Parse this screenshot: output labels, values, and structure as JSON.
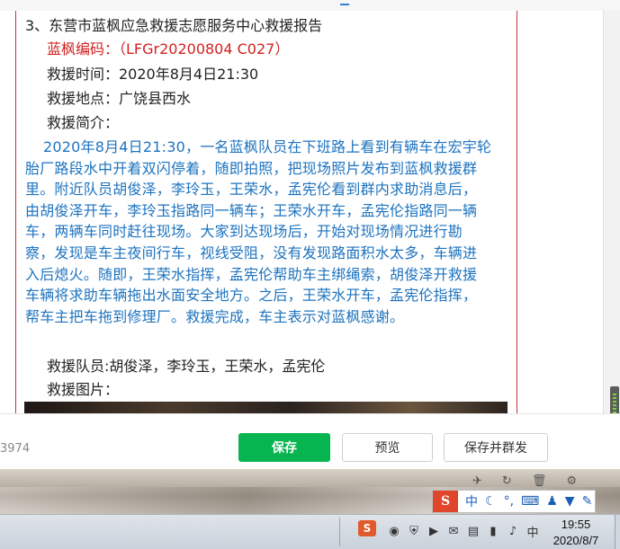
{
  "report": {
    "heading": "3、东营市蓝枫应急救援志愿服务中心救援报告",
    "code": "蓝枫编码：（LFGr20200804 C027）",
    "time": "救援时间：2020年8月4日21:30",
    "place": "救援地点：广饶县西水",
    "summary_label": "救援简介：",
    "summary_lines": [
      "2020年8月4日21:30，一名蓝枫队员在下班路上看到有辆车在宏宇轮",
      "胎厂路段水中开着双闪停着，随即拍照，把现场照片发布到蓝枫救援群",
      "里。附近队员胡俊泽，李玲玉，王荣水，孟宪伦看到群内求助消息后，",
      "由胡俊泽开车，李玲玉指路同一辆车；王荣水开车，孟宪伦指路同一辆",
      "车，两辆车同时赶往现场。大家到达现场后，开始对现场情况进行勘",
      "察，发现是车主夜间行车，视线受阻，没有发现路面积水太多，车辆进",
      "入后熄火。随即，王荣水指挥，孟宪伦帮助车主绑绳索，胡俊泽开救援",
      "车辆将求助车辆拖出水面安全地方。之后，王荣水开车，孟宪伦指挥，",
      "帮车主把车拖到修理厂。救援完成，车主表示对蓝枫感谢。"
    ],
    "members": "救援队员:胡俊泽，李玲玉，王荣水，孟宪伦",
    "photos_label": "救援图片："
  },
  "toolbar": {
    "counter": "3974",
    "save_label": "保存",
    "preview_label": "预览",
    "publish_label": "保存并群发"
  },
  "ime": {
    "logo": "S",
    "mode": "中",
    "icons": [
      "moon-icon",
      "punctuation-icon",
      "keyboard-icon",
      "user-icon",
      "shirt-icon",
      "wrench-icon"
    ]
  },
  "taskbar": {
    "time": "19:55",
    "date": "2020/8/7"
  },
  "colors": {
    "accent_green": "#07b550",
    "report_red": "#d32020",
    "report_blue": "#1d73bf",
    "border_red": "#c7303a"
  }
}
